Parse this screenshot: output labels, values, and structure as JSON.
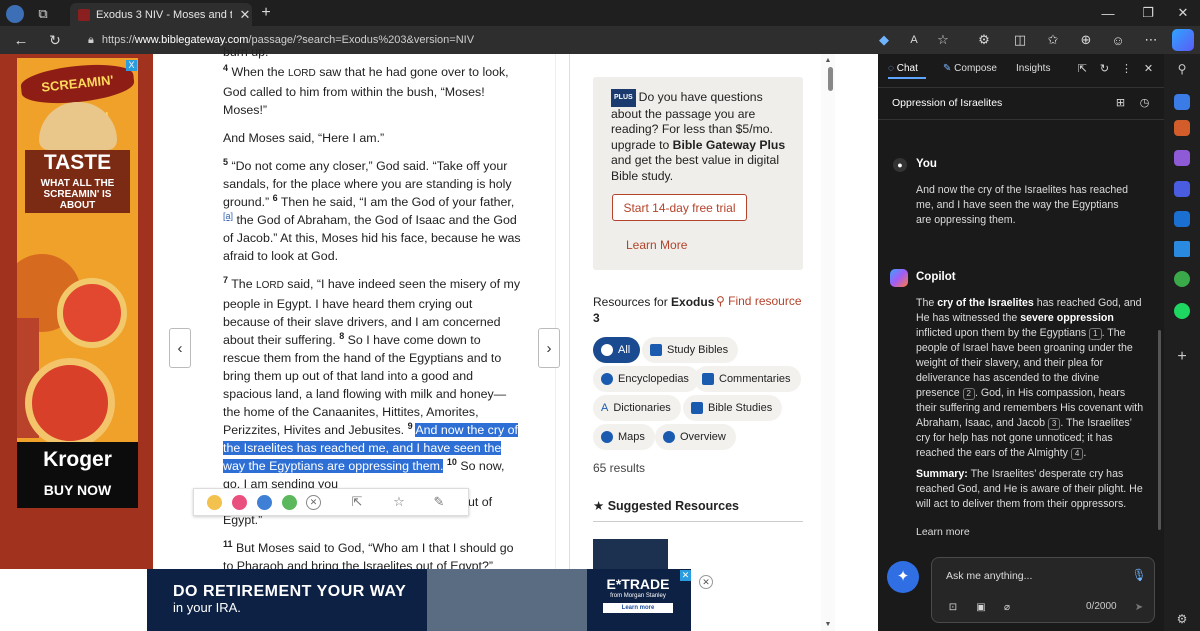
{
  "browser": {
    "tab_title": "Exodus 3 NIV - Moses and the Bu",
    "url_prefix": "https://",
    "url_host": "www.biblegateway.com",
    "url_path": "/passage/?search=Exodus%203&version=NIV"
  },
  "left_ad": {
    "brand": "SCREAMIN' SICILIAN",
    "sub_brand": "PIZZA CO.",
    "headline": "TASTE",
    "tagline": "WHAT ALL THE SCREAMIN' IS ABOUT",
    "store": "Kroger",
    "cta": "BUY NOW",
    "close": "X"
  },
  "passage": {
    "partial_top": "burn up.",
    "v4_num": "4",
    "v4a": "When the ",
    "lord": "Lord",
    "v4b": " saw that he had gone over to look, God called to him from within the bush, “Moses! Moses!”",
    "v4c": "And Moses said, “Here I am.”",
    "v5_num": "5",
    "v5a": "“Do not come any closer,” God said. “Take off your sandals, for the place where you are standing is holy ground.” ",
    "v6_num": "6",
    "v6a": "Then he said, “I am the God of your father, ",
    "footnote": "[a]",
    "v6b": " the God of Abraham, the God of Isaac and the God of Jacob.” At this, Moses hid his face, because he was afraid to look at God.",
    "v7_num": "7",
    "v7a": "The ",
    "v7b": " said, “I have indeed seen the misery of my people in Egypt. I have heard them crying out because of their slave drivers, and I am concerned about their suffering. ",
    "v8_num": "8",
    "v8a": "So I have come down to rescue them from the hand of the Egyptians and to bring them up out of that land into a good and spacious land, a land flowing with milk and honey—the home of the Canaanites, Hittites, Amorites, Perizzites, Hivites and Jebusites. ",
    "v9_num": "9",
    "v9_hl": "And now the cry of the Israelites has reached me, and I have seen the way the Egyptians are oppressing them.",
    "v10_num": "10",
    "v10a": "So now, go. I am sending you",
    "v10b": "ut of",
    "v10c": "Egypt.”",
    "v11_num": "11",
    "v11a": "But Moses said to God, “Who am I that I should go to Pharaoh and bring the Israelites out of Egypt?”"
  },
  "promo": {
    "badge": "PLUS",
    "text_a": "Do you have questions about the passage you are reading? For less than $5/mo. upgrade to ",
    "text_bold": "Bible Gateway Plus",
    "text_b": " and get the best value in digital Bible study.",
    "trial_btn": "Start 14-day free trial",
    "learn_more": "Learn More"
  },
  "resources": {
    "label": "Resources for ",
    "book": "Exodus",
    "chapter": "3",
    "find": "Find resource",
    "chips": [
      "All",
      "Study Bibles",
      "Encyclopedias",
      "Commentaries",
      "Dictionaries",
      "Bible Studies",
      "Maps",
      "Overview"
    ],
    "count": "65 results",
    "suggested": "Suggested Resources"
  },
  "bottom_ad": {
    "headline": "DO RETIREMENT YOUR WAY",
    "sub": "in your IRA.",
    "brand": "E*TRADE",
    "brand_sub": "from Morgan Stanley",
    "cta": "Learn more"
  },
  "copilot": {
    "tabs": [
      "Chat",
      "Compose",
      "Insights"
    ],
    "conversation_title": "Oppression of Israelites",
    "user_name": "You",
    "user_msg": "And now the cry of the Israelites has reached me, and I have seen the way the Egyptians are oppressing them.",
    "bot_name": "Copilot",
    "bot_a": "The ",
    "bot_b1": "cry of the Israelites",
    "bot_c": " has reached God, and He has witnessed the ",
    "bot_b2": "severe oppression",
    "bot_d": " inflicted upon them by the Egyptians ",
    "ref1": "1",
    "bot_e": ". The people of Israel have been groaning under the weight of their slavery, and their plea for deliverance has ascended to the divine presence ",
    "ref2": "2",
    "bot_f": ". God, in His compassion, hears their suffering and remembers His covenant with Abraham, Isaac, and Jacob ",
    "ref3": "3",
    "bot_g": ". The Israelites’ cry for help has not gone unnoticed; it has reached the ears of the Almighty ",
    "ref4": "4",
    "bot_h": ".",
    "summary_label": "Summary:",
    "summary": " The Israelites’ desperate cry has reached God, and He is aware of their plight. He will act to deliver them from their oppressors.",
    "learn_more": "Learn more",
    "ask_placeholder": "Ask me anything...",
    "char_count": "0/2000"
  },
  "colors": {
    "highlight": "#2e6fd6",
    "accent_red": "#b3432b",
    "copilot_bg": "#1a1a1a"
  }
}
